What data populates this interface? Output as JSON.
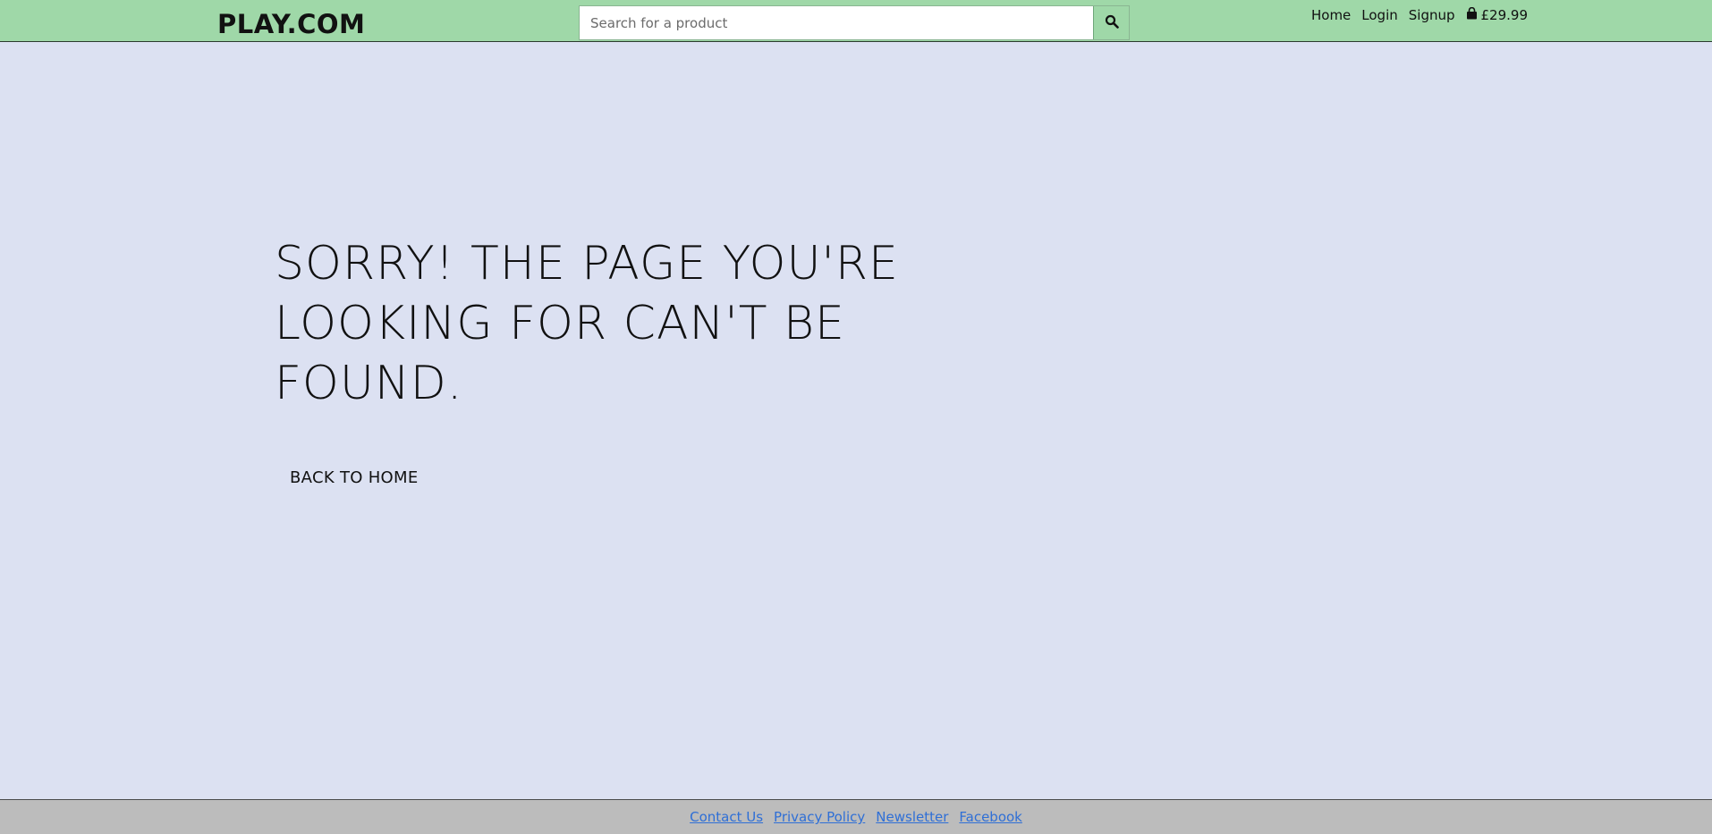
{
  "header": {
    "brand": "PLAY.COM",
    "search": {
      "placeholder": "Search for a product",
      "value": ""
    },
    "nav": {
      "home": "Home",
      "login": "Login",
      "signup": "Signup",
      "cart_total": "£29.99"
    },
    "icons": {
      "search": "search-icon",
      "cart": "shopping-bag-icon"
    }
  },
  "main": {
    "title": "SORRY! THE PAGE YOU'RE LOOKING FOR CAN'T BE FOUND.",
    "back_link": "BACK TO HOME"
  },
  "footer": {
    "links": [
      "Contact Us",
      "Privacy Policy",
      "Newsletter",
      "Facebook"
    ]
  },
  "colors": {
    "page_background": "#dce1f2",
    "header_background": "#9fd8a8",
    "footer_background": "#bcbcbc",
    "footer_link": "#2f6fd6"
  }
}
